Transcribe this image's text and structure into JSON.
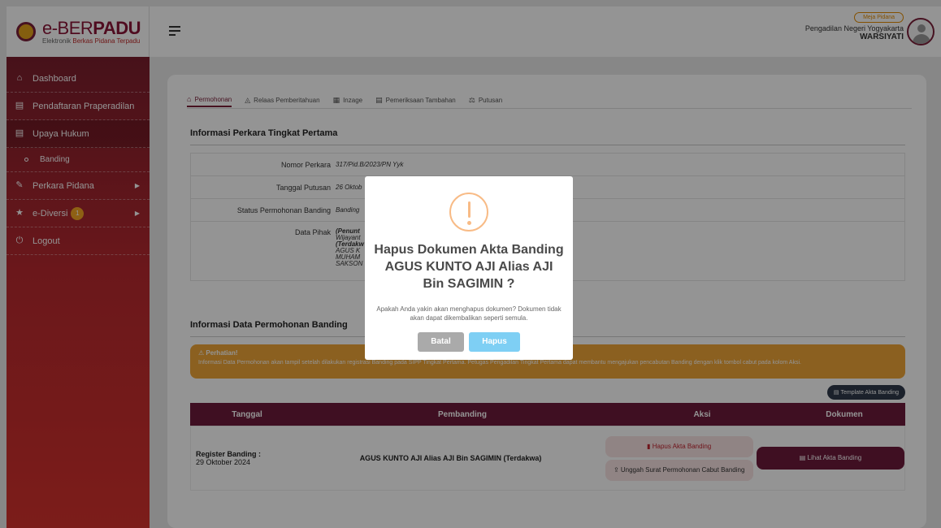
{
  "brand": {
    "title_bold": "e-BER",
    "title_bold2": "PADU",
    "subtitle_a": "Elektronik ",
    "subtitle_b": "Berkas Pidana Terpadu"
  },
  "header": {
    "role_badge": "Meja Pidana",
    "court": "Pengadilan Negeri Yogyakarta",
    "user": "WARSIYATI"
  },
  "sidebar": {
    "dashboard": "Dashboard",
    "praperadilan": "Pendaftaran Praperadilan",
    "upaya_hukum": "Upaya Hukum",
    "banding": "Banding",
    "perkara_pidana": "Perkara Pidana",
    "ediversi": "e-Diversi",
    "ediversi_count": "1",
    "logout": "Logout"
  },
  "tabs": [
    "Permohonan",
    "Relaas Pemberitahuan",
    "Inzage",
    "Pemeriksaan Tambahan",
    "Putusan"
  ],
  "section1": {
    "title": "Informasi Perkara Tingkat Pertama",
    "nomor_label": "Nomor Perkara",
    "nomor_value": "317/Pid.B/2023/PN Yyk",
    "tanggal_label": "Tanggal Putusan",
    "tanggal_value": "26 Oktob",
    "status_label": "Status Permohonan Banding",
    "status_value": "Banding",
    "pihak_label": "Data Pihak",
    "pihak_lines": [
      "(Penunt",
      "Wijayant",
      "(Terdakw",
      "AGUS K",
      "MUHAM",
      "SAKSON"
    ]
  },
  "section2": {
    "title": "Informasi Data Permohonan Banding",
    "warning_title": "Perhatian!",
    "warning_text": "Informasi Data Permohonan akan tampil setelah dilakukan registrasi Banding pada SIPP Tingkat Pertama. Petugas Pengadilan Tingkat Pertama dapat membantu mengajukan pencabutan Banding dengan klik tombol cabut pada kolom Aksi.",
    "template_button": "Template Akta Banding",
    "table_headers": [
      "Tanggal",
      "Pembanding",
      "Aksi",
      "Dokumen"
    ],
    "row": {
      "register_label": "Register Banding :",
      "register_date": "29 Oktober 2024",
      "pembanding": "AGUS KUNTO AJI Alias AJI Bin SAGIMIN (Terdakwa)",
      "hapus_btn": "Hapus Akta Banding",
      "unggah_btn": "Unggah Surat Permohonan Cabut Banding",
      "lihat_btn": "Lihat Akta Banding"
    }
  },
  "modal": {
    "title": "Hapus Dokumen Akta Banding AGUS KUNTO AJI Alias AJI Bin SAGIMIN ?",
    "text": "Apakah Anda yakin akan menghapus dokumen? Dokumen tidak akan dapat dikembalikan seperti semula.",
    "cancel": "Batal",
    "confirm": "Hapus"
  },
  "colors": {
    "primary": "#6d1a3c",
    "warning": "#f0a637",
    "confirm": "#7ecff4",
    "cancel": "#aaaaaa"
  }
}
